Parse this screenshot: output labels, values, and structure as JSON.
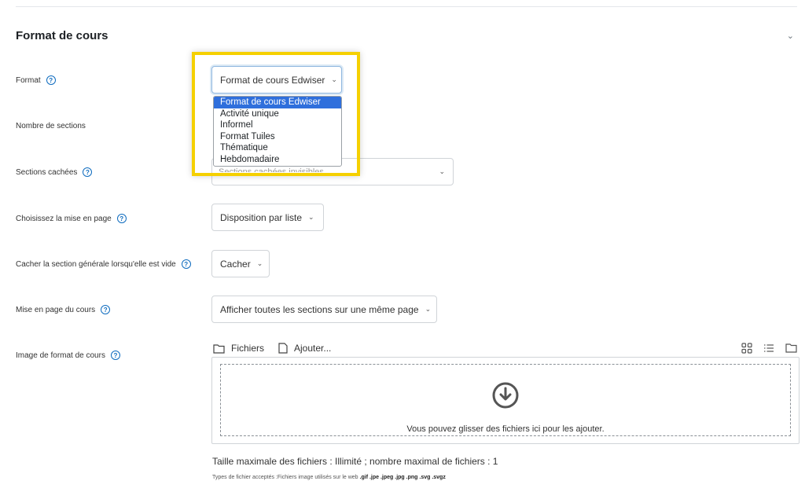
{
  "section": {
    "title": "Format de cours"
  },
  "rows": {
    "format": {
      "label": "Format",
      "value": "Format de cours Edwiser"
    },
    "nombre_sections": {
      "label": "Nombre de sections"
    },
    "sections_cachees": {
      "label": "Sections cachées",
      "value": "Sections cachées invisibles"
    },
    "mise_en_page": {
      "label": "Choisissez la mise en page",
      "value": "Disposition par liste"
    },
    "cacher_generale": {
      "label": "Cacher la section générale lorsqu'elle est vide",
      "value": "Cacher"
    },
    "mise_page_cours": {
      "label": "Mise en page du cours",
      "value": "Afficher toutes les sections sur une même page"
    },
    "image_format": {
      "label": "Image de format de cours"
    }
  },
  "dropdown": {
    "options": [
      "Format de cours Edwiser",
      "Activité unique",
      "Informel",
      "Format Tuiles",
      "Thématique",
      "Hebdomadaire"
    ],
    "selected_index": 0
  },
  "filepicker": {
    "files_label": "Fichiers",
    "add_label": "Ajouter...",
    "drop_text": "Vous pouvez glisser des fichiers ici pour les ajouter.",
    "limits": "Taille maximale des fichiers : Illimité ; nombre maximal de fichiers : 1",
    "types_prefix": "Types de fichier acceptés :Fichiers image utilisés sur le web",
    "types_list": ".gif .jpe .jpeg .jpg .png .svg .svgz"
  },
  "colors": {
    "accent": "#0f6cbf",
    "highlight": "#f5d000",
    "selected_option": "#2f6fdc"
  }
}
